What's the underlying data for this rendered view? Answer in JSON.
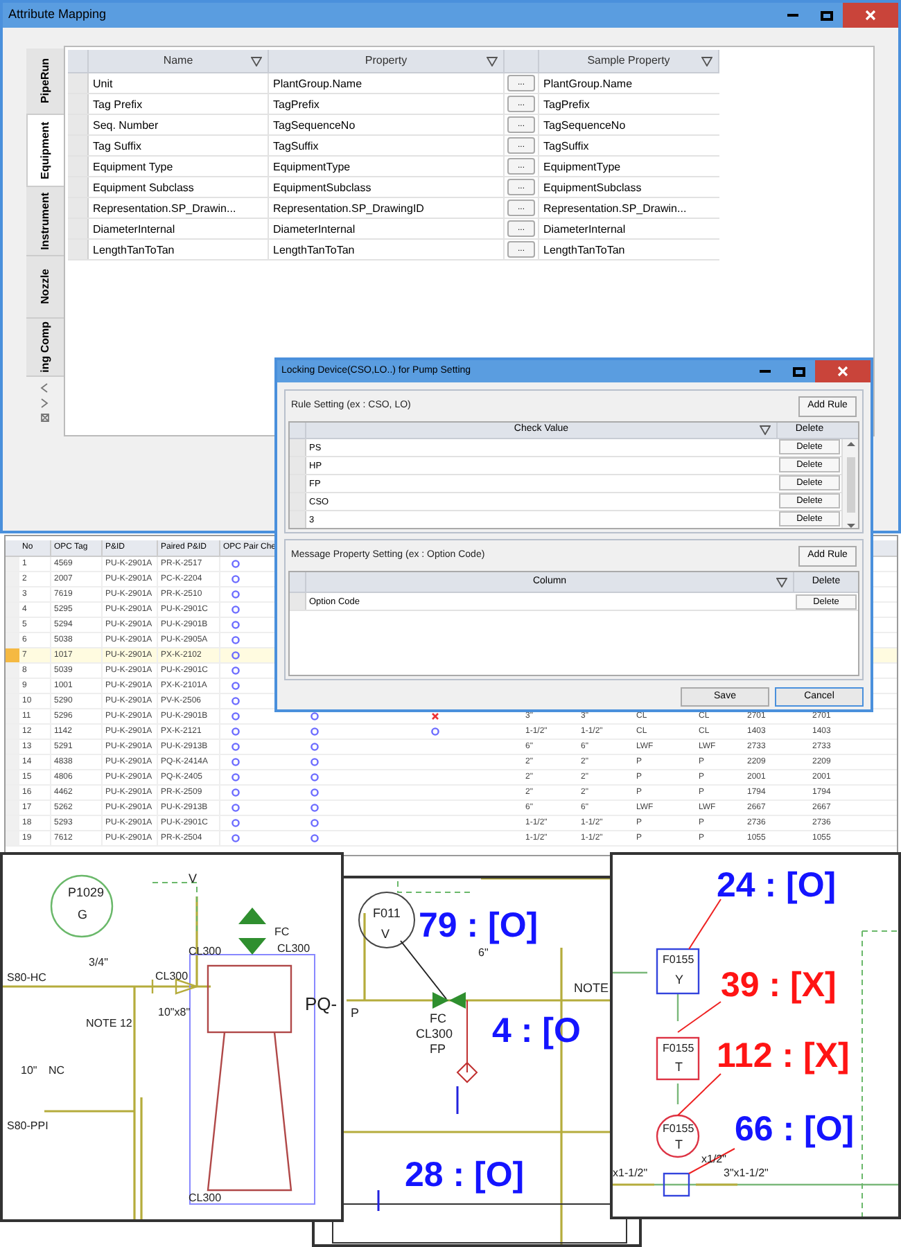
{
  "attribute_mapping": {
    "title": "Attribute Mapping",
    "tabs": [
      {
        "label": "PipeRun",
        "selected": false
      },
      {
        "label": "Equipment",
        "selected": true
      },
      {
        "label": "Instrument",
        "selected": false
      },
      {
        "label": "Nozzle",
        "selected": false
      },
      {
        "label": "ing Comp",
        "selected": false
      }
    ],
    "columns": [
      "Name",
      "Property",
      "Sample Property"
    ],
    "rows": [
      {
        "name": "Unit",
        "property": "PlantGroup.Name",
        "button": "...",
        "sample": "PlantGroup.Name"
      },
      {
        "name": "Tag Prefix",
        "property": "TagPrefix",
        "button": "...",
        "sample": "TagPrefix"
      },
      {
        "name": "Seq. Number",
        "property": "TagSequenceNo",
        "button": "...",
        "sample": "TagSequenceNo"
      },
      {
        "name": "Tag Suffix",
        "property": "TagSuffix",
        "button": "...",
        "sample": "TagSuffix"
      },
      {
        "name": "Equipment Type",
        "property": "EquipmentType",
        "button": "...",
        "sample": "EquipmentType"
      },
      {
        "name": "Equipment Subclass",
        "property": "EquipmentSubclass",
        "button": "...",
        "sample": "EquipmentSubclass"
      },
      {
        "name": "Representation.SP_Drawin...",
        "property": "Representation.SP_DrawingID",
        "button": "...",
        "sample": "Representation.SP_Drawin..."
      },
      {
        "name": "DiameterInternal",
        "property": "DiameterInternal",
        "button": "...",
        "sample": "DiameterInternal"
      },
      {
        "name": "LengthTanToTan",
        "property": "LengthTanToTan",
        "button": "...",
        "sample": "LengthTanToTan"
      }
    ]
  },
  "result_table": {
    "columns": [
      "No",
      "OPC Tag",
      "P&ID",
      "Paired P&ID",
      "OPC Pair Che"
    ],
    "rows": [
      {
        "no": "1",
        "opc_tag": "4569",
        "pid": "PU-K-2901A",
        "paired_pid": "PR-K-2517",
        "selected": false,
        "checks": [
          {
            "kind": "ok"
          }
        ]
      },
      {
        "no": "2",
        "opc_tag": "2007",
        "pid": "PU-K-2901A",
        "paired_pid": "PC-K-2204",
        "selected": false,
        "checks": [
          {
            "kind": "ok"
          }
        ]
      },
      {
        "no": "3",
        "opc_tag": "7619",
        "pid": "PU-K-2901A",
        "paired_pid": "PR-K-2510",
        "selected": false,
        "checks": [
          {
            "kind": "ok"
          }
        ]
      },
      {
        "no": "4",
        "opc_tag": "5295",
        "pid": "PU-K-2901A",
        "paired_pid": "PU-K-2901C",
        "selected": false,
        "checks": [
          {
            "kind": "ok"
          }
        ]
      },
      {
        "no": "5",
        "opc_tag": "5294",
        "pid": "PU-K-2901A",
        "paired_pid": "PU-K-2901B",
        "selected": false,
        "checks": [
          {
            "kind": "ok"
          }
        ]
      },
      {
        "no": "6",
        "opc_tag": "5038",
        "pid": "PU-K-2901A",
        "paired_pid": "PU-K-2905A",
        "selected": false,
        "checks": [
          {
            "kind": "ok"
          }
        ]
      },
      {
        "no": "7",
        "opc_tag": "1017",
        "pid": "PU-K-2901A",
        "paired_pid": "PX-K-2102",
        "selected": true,
        "checks": [
          {
            "kind": "ok"
          }
        ]
      },
      {
        "no": "8",
        "opc_tag": "5039",
        "pid": "PU-K-2901A",
        "paired_pid": "PU-K-2901C",
        "selected": false,
        "checks": [
          {
            "kind": "ok"
          }
        ]
      },
      {
        "no": "9",
        "opc_tag": "1001",
        "pid": "PU-K-2901A",
        "paired_pid": "PX-K-2101A",
        "selected": false,
        "checks": [
          {
            "kind": "ok"
          }
        ]
      },
      {
        "no": "10",
        "opc_tag": "5290",
        "pid": "PU-K-2901A",
        "paired_pid": "PV-K-2506",
        "selected": false,
        "checks": [
          {
            "kind": "ok"
          }
        ]
      },
      {
        "no": "11",
        "opc_tag": "5296",
        "pid": "PU-K-2901A",
        "paired_pid": "PU-K-2901B",
        "selected": false,
        "checks": [
          {
            "kind": "ok"
          },
          {
            "kind": "ok"
          },
          {
            "kind": "error"
          }
        ],
        "cells": [
          "3\"",
          "3\"",
          "CL",
          "CL",
          "2701",
          "2701"
        ]
      },
      {
        "no": "12",
        "opc_tag": "1142",
        "pid": "PU-K-2901A",
        "paired_pid": "PX-K-2121",
        "selected": false,
        "checks": [
          {
            "kind": "ok"
          },
          {
            "kind": "ok"
          },
          {
            "kind": "ok"
          }
        ],
        "cells": [
          "1-1/2\"",
          "1-1/2\"",
          "CL",
          "CL",
          "1403",
          "1403"
        ]
      },
      {
        "no": "13",
        "opc_tag": "5291",
        "pid": "PU-K-2901A",
        "paired_pid": "PU-K-2913B",
        "selected": false,
        "checks": [
          {
            "kind": "ok"
          },
          {
            "kind": "ok"
          }
        ],
        "cells": [
          "6\"",
          "6\"",
          "LWF",
          "LWF",
          "2733",
          "2733"
        ]
      },
      {
        "no": "14",
        "opc_tag": "4838",
        "pid": "PU-K-2901A",
        "paired_pid": "PQ-K-2414A",
        "selected": false,
        "checks": [
          {
            "kind": "ok"
          },
          {
            "kind": "ok"
          }
        ],
        "cells": [
          "2\"",
          "2\"",
          "P",
          "P",
          "2209",
          "2209"
        ]
      },
      {
        "no": "15",
        "opc_tag": "4806",
        "pid": "PU-K-2901A",
        "paired_pid": "PQ-K-2405",
        "selected": false,
        "checks": [
          {
            "kind": "ok"
          },
          {
            "kind": "ok"
          }
        ],
        "cells": [
          "2\"",
          "2\"",
          "P",
          "P",
          "2001",
          "2001"
        ]
      },
      {
        "no": "16",
        "opc_tag": "4462",
        "pid": "PU-K-2901A",
        "paired_pid": "PR-K-2509",
        "selected": false,
        "checks": [
          {
            "kind": "ok"
          },
          {
            "kind": "ok"
          }
        ],
        "cells": [
          "2\"",
          "2\"",
          "P",
          "P",
          "1794",
          "1794"
        ]
      },
      {
        "no": "17",
        "opc_tag": "5262",
        "pid": "PU-K-2901A",
        "paired_pid": "PU-K-2913B",
        "selected": false,
        "checks": [
          {
            "kind": "ok"
          },
          {
            "kind": "ok"
          }
        ],
        "cells": [
          "6\"",
          "6\"",
          "LWF",
          "LWF",
          "2667",
          "2667"
        ]
      },
      {
        "no": "18",
        "opc_tag": "5293",
        "pid": "PU-K-2901A",
        "paired_pid": "PU-K-2901C",
        "selected": false,
        "checks": [
          {
            "kind": "ok"
          },
          {
            "kind": "ok"
          }
        ],
        "cells": [
          "1-1/2\"",
          "1-1/2\"",
          "P",
          "P",
          "2736",
          "2736"
        ]
      },
      {
        "no": "19",
        "opc_tag": "7612",
        "pid": "PU-K-2901A",
        "paired_pid": "PR-K-2504",
        "selected": false,
        "checks": [
          {
            "kind": "ok"
          },
          {
            "kind": "ok"
          }
        ],
        "cells": [
          "1-1/2\"",
          "1-1/2\"",
          "P",
          "P",
          "1055",
          "1055"
        ]
      }
    ]
  },
  "pump_setting_dialog": {
    "title": "Locking Device(CSO,LO..) for Pump Setting",
    "rule_section": {
      "label": "Rule Setting (ex : CSO, LO)",
      "add_button": "Add Rule",
      "columns": [
        "Check Value",
        "Delete"
      ],
      "rows": [
        {
          "value": "PS",
          "button": "Delete"
        },
        {
          "value": "HP",
          "button": "Delete"
        },
        {
          "value": "FP",
          "button": "Delete"
        },
        {
          "value": "CSO",
          "button": "Delete"
        },
        {
          "value": "3",
          "button": "Delete"
        }
      ]
    },
    "message_section": {
      "label": "Message Property Setting (ex : Option Code)",
      "add_button": "Add Rule",
      "columns": [
        "Column",
        "Delete"
      ],
      "rows": [
        {
          "value": "Option Code",
          "button": "Delete"
        }
      ]
    },
    "buttons": [
      "Save",
      "Cancel"
    ]
  },
  "drawing_panels": [
    {
      "labels": [
        "V",
        "P1029",
        "G",
        "3/4\"",
        "S80-HC",
        "NOTE 12",
        "CL300",
        "10\"x8\"",
        "CL300",
        "FC",
        "CL300",
        "CL300",
        "NC",
        "10\"",
        "S80-PPI",
        "PQ-"
      ]
    },
    {
      "labels": [
        "F011",
        "V",
        "6\"",
        "P",
        "FC",
        "CL300",
        "FP",
        "NOTE"
      ],
      "results": [
        {
          "text": "79 : [O]",
          "color": "#1414ff"
        },
        {
          "text": "4 : [O",
          "color": "#1414ff"
        },
        {
          "text": "28 : [O]",
          "color": "#1414ff"
        }
      ]
    },
    {
      "labels": [
        "F0155",
        "Y",
        "F0155",
        "T",
        "F0155",
        "T",
        "x1-1/2\"",
        "x1/2\"",
        "3\"x1-1/2\""
      ],
      "results": [
        {
          "text": "24 : [O]",
          "color": "#1414ff"
        },
        {
          "text": "39 : [X]",
          "color": "#ff1414"
        },
        {
          "text": "112 : [X]",
          "color": "#ff1414"
        },
        {
          "text": "66 : [O]",
          "color": "#1414ff"
        }
      ]
    }
  ]
}
